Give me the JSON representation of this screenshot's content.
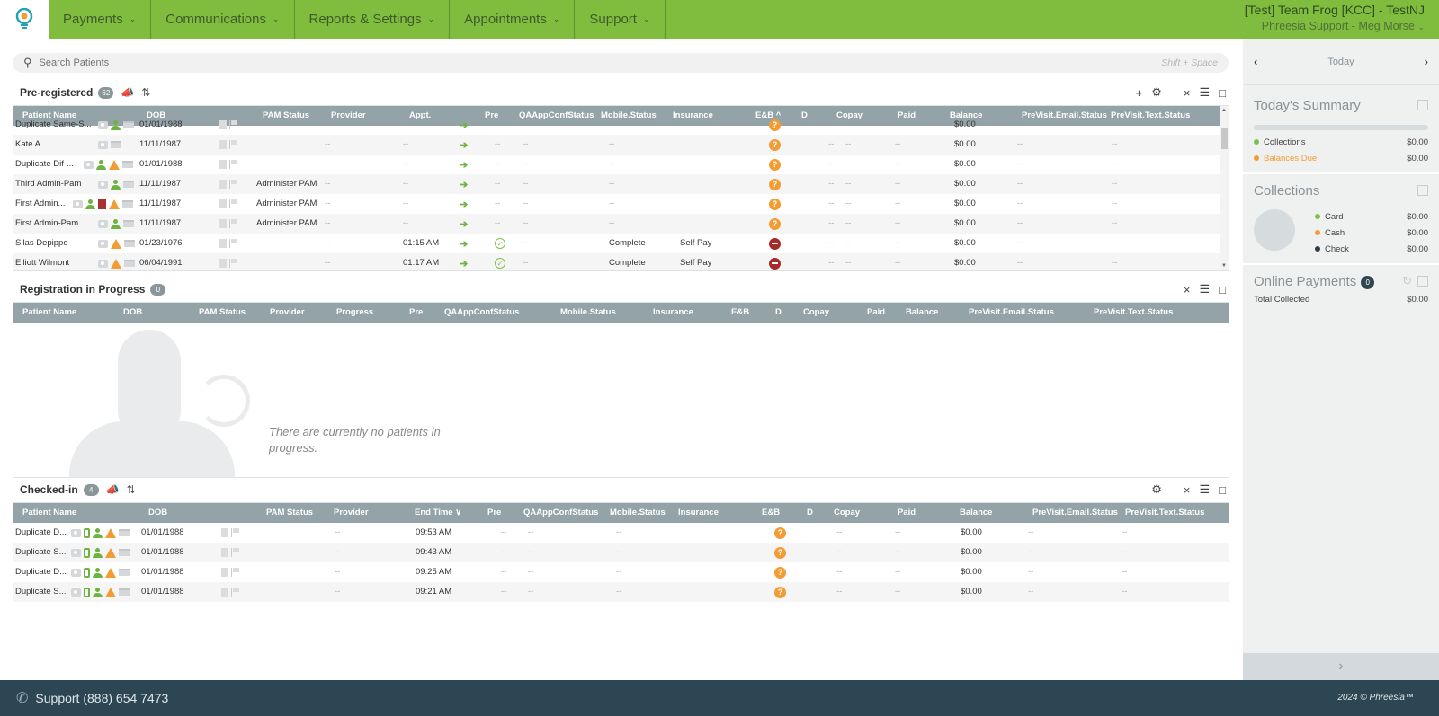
{
  "topnav": {
    "items": [
      "Payments",
      "Communications",
      "Reports & Settings",
      "Appointments",
      "Support"
    ],
    "org_name": "[Test] Team Frog [KCC] - TestNJ",
    "user": "Phreesia Support - Meg Morse"
  },
  "search": {
    "placeholder": "Search Patients",
    "hint": "Shift + Space"
  },
  "preregistered": {
    "title": "Pre-registered",
    "count": "62",
    "columns": [
      "Patient Name",
      "DOB",
      "PAM Status",
      "Provider",
      "Appt.",
      "Pre",
      "QAAppConfStatus",
      "Mobile.Status",
      "Insurance",
      "E&B ^",
      "D",
      "Copay",
      "Paid",
      "Balance",
      "PreVisit.Email.Status",
      "PreVisit.Text.Status"
    ],
    "rows": [
      {
        "name": "Duplicate Same-S...",
        "dob": "01/01/1988",
        "pam": "",
        "provider": "",
        "appt": "",
        "pre": "",
        "qa": "",
        "mobile": "",
        "insurance": "",
        "eb": "question",
        "d": "",
        "copay": "",
        "paid": "",
        "balance": "$0.00",
        "email": "",
        "text": "",
        "icons": [
          "camera",
          "person",
          "card"
        ]
      },
      {
        "name": "Kate A",
        "dob": "11/11/1987",
        "pam": "",
        "provider": "--",
        "appt": "--",
        "pre": "--",
        "qa": "--",
        "mobile": "--",
        "insurance": "",
        "eb": "question",
        "d": "--",
        "copay": "--",
        "paid": "--",
        "balance": "$0.00",
        "email": "--",
        "text": "--",
        "icons": [
          "camera",
          "card"
        ]
      },
      {
        "name": "Duplicate Dif-...",
        "dob": "01/01/1988",
        "pam": "",
        "provider": "--",
        "appt": "--",
        "pre": "--",
        "qa": "--",
        "mobile": "--",
        "insurance": "",
        "eb": "question",
        "d": "--",
        "copay": "--",
        "paid": "--",
        "balance": "$0.00",
        "email": "--",
        "text": "--",
        "icons": [
          "camera",
          "person",
          "warning",
          "card"
        ]
      },
      {
        "name": "Third Admin-Pam",
        "dob": "11/11/1987",
        "pam": "Administer PAM",
        "provider": "--",
        "appt": "--",
        "pre": "--",
        "qa": "--",
        "mobile": "--",
        "insurance": "",
        "eb": "question",
        "d": "--",
        "copay": "--",
        "paid": "--",
        "balance": "$0.00",
        "email": "--",
        "text": "--",
        "icons": [
          "camera",
          "person",
          "card"
        ]
      },
      {
        "name": "First Admin...",
        "dob": "11/11/1987",
        "pam": "Administer PAM",
        "provider": "--",
        "appt": "--",
        "pre": "--",
        "qa": "--",
        "mobile": "--",
        "insurance": "",
        "eb": "question",
        "d": "--",
        "copay": "--",
        "paid": "--",
        "balance": "$0.00",
        "email": "--",
        "text": "--",
        "icons": [
          "camera",
          "person",
          "form",
          "warning",
          "card"
        ]
      },
      {
        "name": "First Admin-Pam",
        "dob": "11/11/1987",
        "pam": "Administer PAM",
        "provider": "--",
        "appt": "--",
        "pre": "--",
        "qa": "--",
        "mobile": "--",
        "insurance": "",
        "eb": "question",
        "d": "--",
        "copay": "--",
        "paid": "--",
        "balance": "$0.00",
        "email": "--",
        "text": "--",
        "icons": [
          "camera",
          "person",
          "card"
        ]
      },
      {
        "name": "Silas Depippo",
        "dob": "01/23/1976",
        "pam": "",
        "provider": "--",
        "appt": "01:15 AM",
        "pre": "check",
        "qa": "--",
        "mobile": "Complete",
        "insurance": "Self Pay",
        "eb": "denied",
        "d": "--",
        "copay": "--",
        "paid": "--",
        "balance": "$0.00",
        "email": "--",
        "text": "--",
        "icons": [
          "camera",
          "warning",
          "card"
        ]
      },
      {
        "name": "Elliott Wilmont",
        "dob": "06/04/1991",
        "pam": "",
        "provider": "--",
        "appt": "01:17 AM",
        "pre": "check",
        "qa": "--",
        "mobile": "Complete",
        "insurance": "Self Pay",
        "eb": "denied",
        "d": "--",
        "copay": "--",
        "paid": "--",
        "balance": "$0.00",
        "email": "--",
        "text": "--",
        "icons": [
          "camera",
          "warning",
          "card"
        ]
      }
    ]
  },
  "in_progress": {
    "title": "Registration in Progress",
    "count": "0",
    "columns": [
      "Patient Name",
      "DOB",
      "PAM Status",
      "Provider",
      "Progress",
      "Pre",
      "QAAppConfStatus",
      "Mobile.Status",
      "Insurance",
      "E&B",
      "D",
      "Copay",
      "Paid",
      "Balance",
      "PreVisit.Email.Status",
      "PreVisit.Text.Status"
    ],
    "empty_message": "There are currently no patients in progress."
  },
  "checked_in": {
    "title": "Checked-in",
    "count": "4",
    "columns": [
      "Patient Name",
      "DOB",
      "PAM Status",
      "Provider",
      "End Time ∨",
      "Pre",
      "QAAppConfStatus",
      "Mobile.Status",
      "Insurance",
      "E&B",
      "D",
      "Copay",
      "Paid",
      "Balance",
      "PreVisit.Email.Status",
      "PreVisit.Text.Status"
    ],
    "rows": [
      {
        "name": "Duplicate D...",
        "dob": "01/01/1988",
        "provider": "--",
        "end": "09:53 AM",
        "pre": "--",
        "qa": "--",
        "mobile": "--",
        "d": "--",
        "copay": "--",
        "paid": "--",
        "balance": "$0.00",
        "email": "--",
        "text": "--"
      },
      {
        "name": "Duplicate S...",
        "dob": "01/01/1988",
        "provider": "--",
        "end": "09:43 AM",
        "pre": "--",
        "qa": "--",
        "mobile": "--",
        "d": "--",
        "copay": "--",
        "paid": "--",
        "balance": "$0.00",
        "email": "--",
        "text": "--"
      },
      {
        "name": "Duplicate D...",
        "dob": "01/01/1988",
        "provider": "--",
        "end": "09:25 AM",
        "pre": "--",
        "qa": "--",
        "mobile": "--",
        "d": "--",
        "copay": "--",
        "paid": "--",
        "balance": "$0.00",
        "email": "--",
        "text": "--"
      },
      {
        "name": "Duplicate S...",
        "dob": "01/01/1988",
        "provider": "--",
        "end": "09:21 AM",
        "pre": "--",
        "qa": "--",
        "mobile": "--",
        "d": "--",
        "copay": "--",
        "paid": "--",
        "balance": "$0.00",
        "email": "--",
        "text": "--"
      }
    ]
  },
  "rail": {
    "date_label": "Today",
    "summary": {
      "title": "Today's Summary",
      "items": [
        {
          "label": "Collections",
          "value": "$0.00",
          "color": "#7cc04b"
        },
        {
          "label": "Balances Due",
          "value": "$0.00",
          "color": "#f39c33"
        }
      ]
    },
    "collections": {
      "title": "Collections",
      "items": [
        {
          "label": "Card",
          "value": "$0.00",
          "color": "#7cc04b"
        },
        {
          "label": "Cash",
          "value": "$0.00",
          "color": "#f39c33"
        },
        {
          "label": "Check",
          "value": "$0.00",
          "color": "#2f3e46"
        }
      ]
    },
    "online": {
      "title": "Online Payments",
      "count": "0",
      "total_label": "Total Collected",
      "total_value": "$0.00"
    }
  },
  "footer": {
    "support": "Support (888) 654 7473",
    "copyright": "2024 © Phreesia™"
  }
}
